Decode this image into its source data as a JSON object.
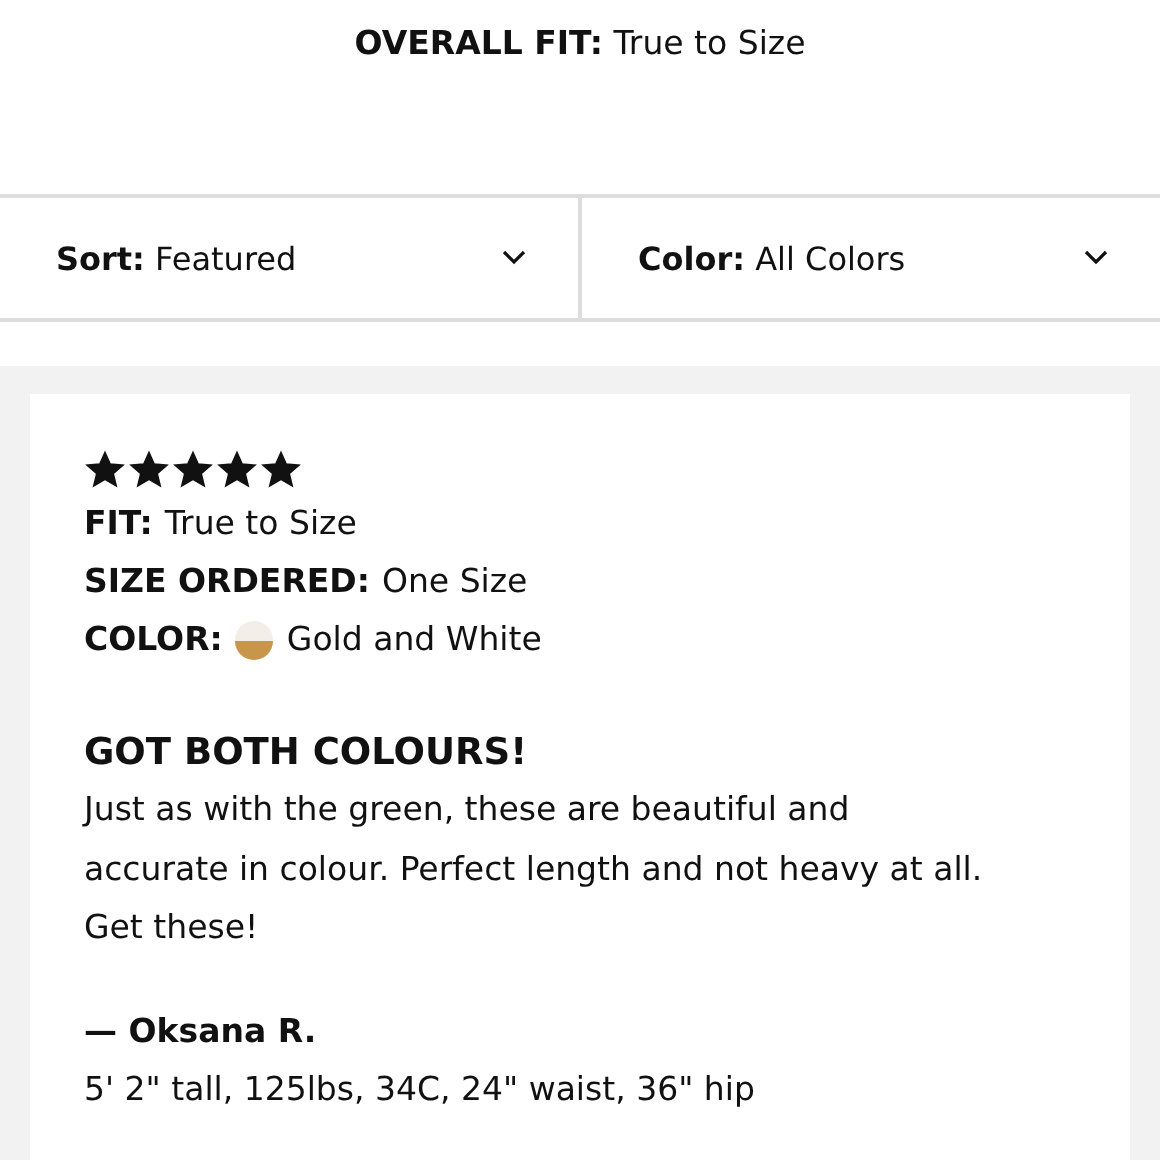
{
  "overall_fit": {
    "label": "OVERALL FIT:",
    "value": "True to Size"
  },
  "filters": [
    {
      "label": "Sort:",
      "value": "Featured"
    },
    {
      "label": "Color:",
      "value": "All Colors"
    }
  ],
  "review": {
    "stars": 5,
    "details": [
      {
        "label": "FIT:",
        "value": "True to Size",
        "kind": "text"
      },
      {
        "label": "SIZE ORDERED:",
        "value": "One Size",
        "kind": "text"
      },
      {
        "label": "COLOR:",
        "value": "Gold and White",
        "kind": "swatch"
      }
    ],
    "title": "GOT BOTH COLOURS!",
    "body": "Just as with the green, these are beautiful and accurate in colour. Perfect length and not heavy at all. Get these!",
    "author": "— Oksana R.",
    "measurements": "5' 2\" tall, 125lbs, 34C, 24\" waist, 36\" hip"
  }
}
